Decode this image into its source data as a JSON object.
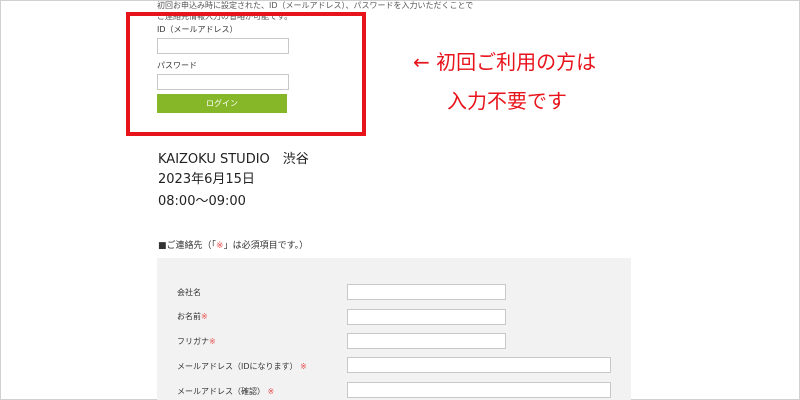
{
  "login_notice": {
    "line1": "初回お申込み時に設定された、ID（メールアドレス）、パスワードを入力いただくことで",
    "line2": "ご連絡先情報入力の省略が可能です。"
  },
  "login": {
    "id_label": "ID（メールアドレス）",
    "password_label": "パスワード",
    "button_label": "ログイン"
  },
  "annotation": {
    "line1": "← 初回ご利用の方は",
    "line2": "入力不要です"
  },
  "event": {
    "venue": "KAIZOKU STUDIO　渋谷",
    "date": "2023年6月15日",
    "time": "08:00〜09:00"
  },
  "contact": {
    "heading_prefix": "■ご連絡先（「",
    "heading_mark": "※",
    "heading_suffix": "」は必須項目です。）",
    "required_mark": "※",
    "fields": [
      {
        "label": "会社名"
      },
      {
        "label": "お名前"
      },
      {
        "label": "フリガナ"
      },
      {
        "label": "メールアドレス（IDになります）"
      },
      {
        "label": "メールアドレス（確認）"
      }
    ]
  }
}
